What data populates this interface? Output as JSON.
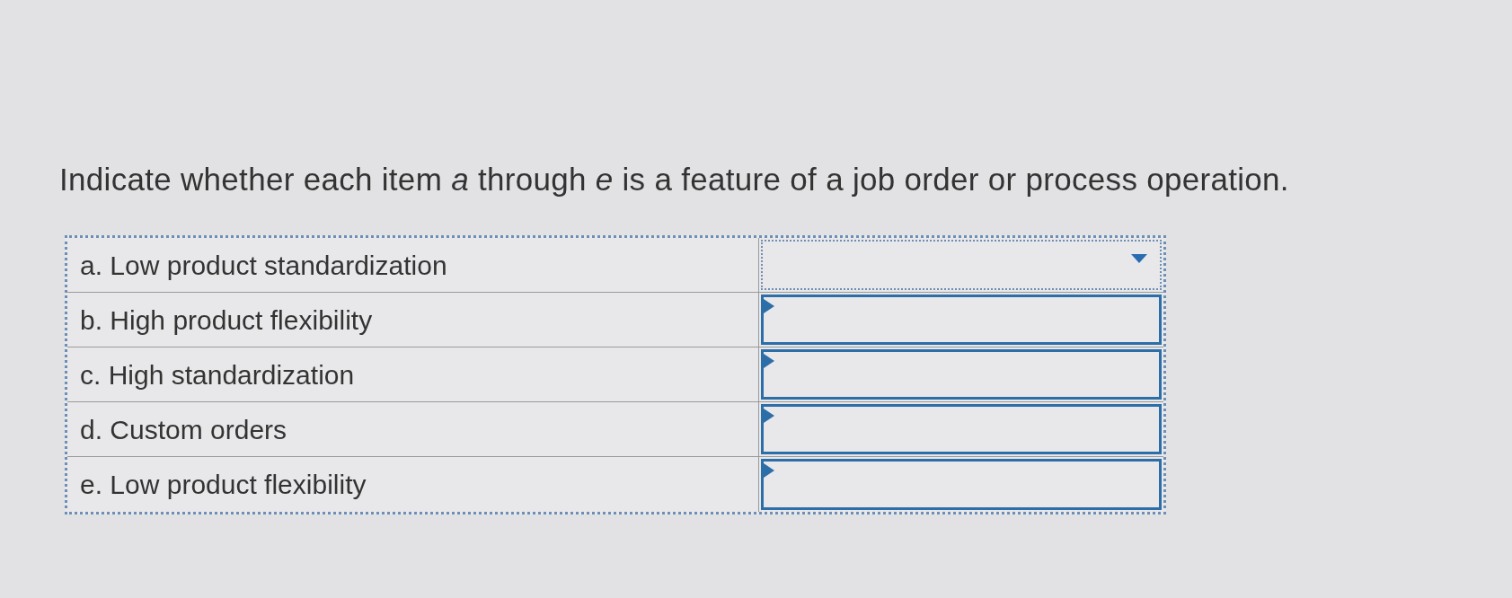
{
  "question": {
    "prefix": "Indicate whether each item ",
    "var_a": "a",
    "middle": " through ",
    "var_e": "e",
    "suffix": " is a feature of a job order or process operation."
  },
  "rows": [
    {
      "label": "a. Low product standardization",
      "focused": true
    },
    {
      "label": "b. High product flexibility",
      "focused": false
    },
    {
      "label": "c. High standardization",
      "focused": false
    },
    {
      "label": "d. Custom orders",
      "focused": false
    },
    {
      "label": "e. Low product flexibility",
      "focused": false
    }
  ]
}
